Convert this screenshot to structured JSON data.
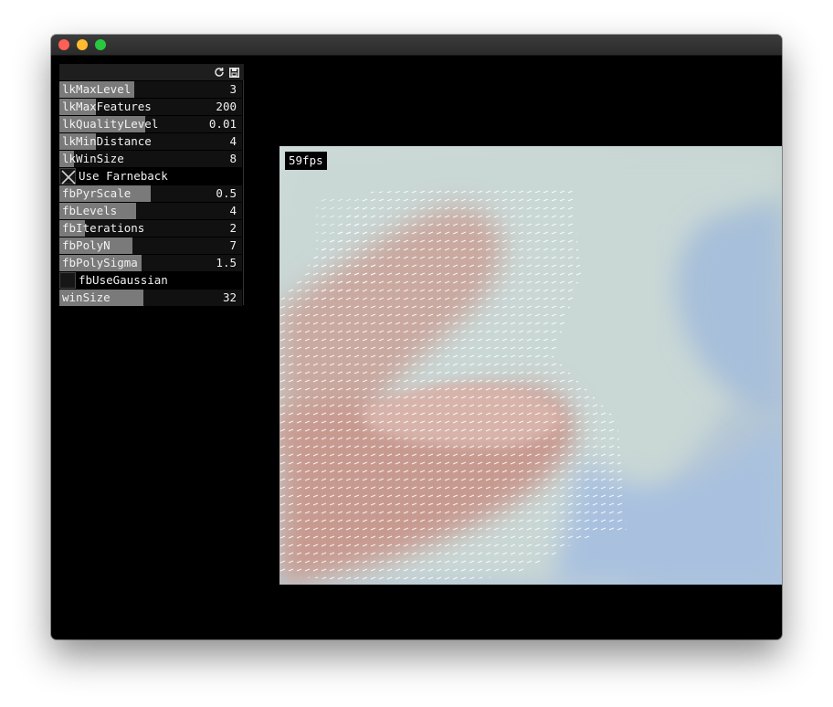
{
  "window": {
    "traffic_lights": [
      "close",
      "minimize",
      "maximize"
    ]
  },
  "panel": {
    "header_icons": [
      "reload-icon",
      "save-icon"
    ],
    "params": [
      {
        "label": "lkMaxLevel",
        "value": "3",
        "fill": 0.41
      },
      {
        "label": "lkMaxFeatures",
        "value": "200",
        "fill": 0.2
      },
      {
        "label": "lkQualityLevel",
        "value": "0.01",
        "fill": 0.47
      },
      {
        "label": "lkMinDistance",
        "value": "4",
        "fill": 0.2
      },
      {
        "label": "lkWinSize",
        "value": "8",
        "fill": 0.08
      },
      {
        "label": "fbPyrScale",
        "value": "0.5",
        "fill": 0.5
      },
      {
        "label": "fbLevels",
        "value": "4",
        "fill": 0.42
      },
      {
        "label": "fbIterations",
        "value": "2",
        "fill": 0.14
      },
      {
        "label": "fbPolyN",
        "value": "7",
        "fill": 0.4
      },
      {
        "label": "fbPolySigma",
        "value": "1.5",
        "fill": 0.45
      },
      {
        "label": "winSize",
        "value": "32",
        "fill": 0.46
      }
    ],
    "toggles": [
      {
        "label": "Use Farneback",
        "checked": true
      },
      {
        "label": "fbUseGaussian",
        "checked": false
      }
    ]
  },
  "video": {
    "fps_label": "59fps"
  }
}
